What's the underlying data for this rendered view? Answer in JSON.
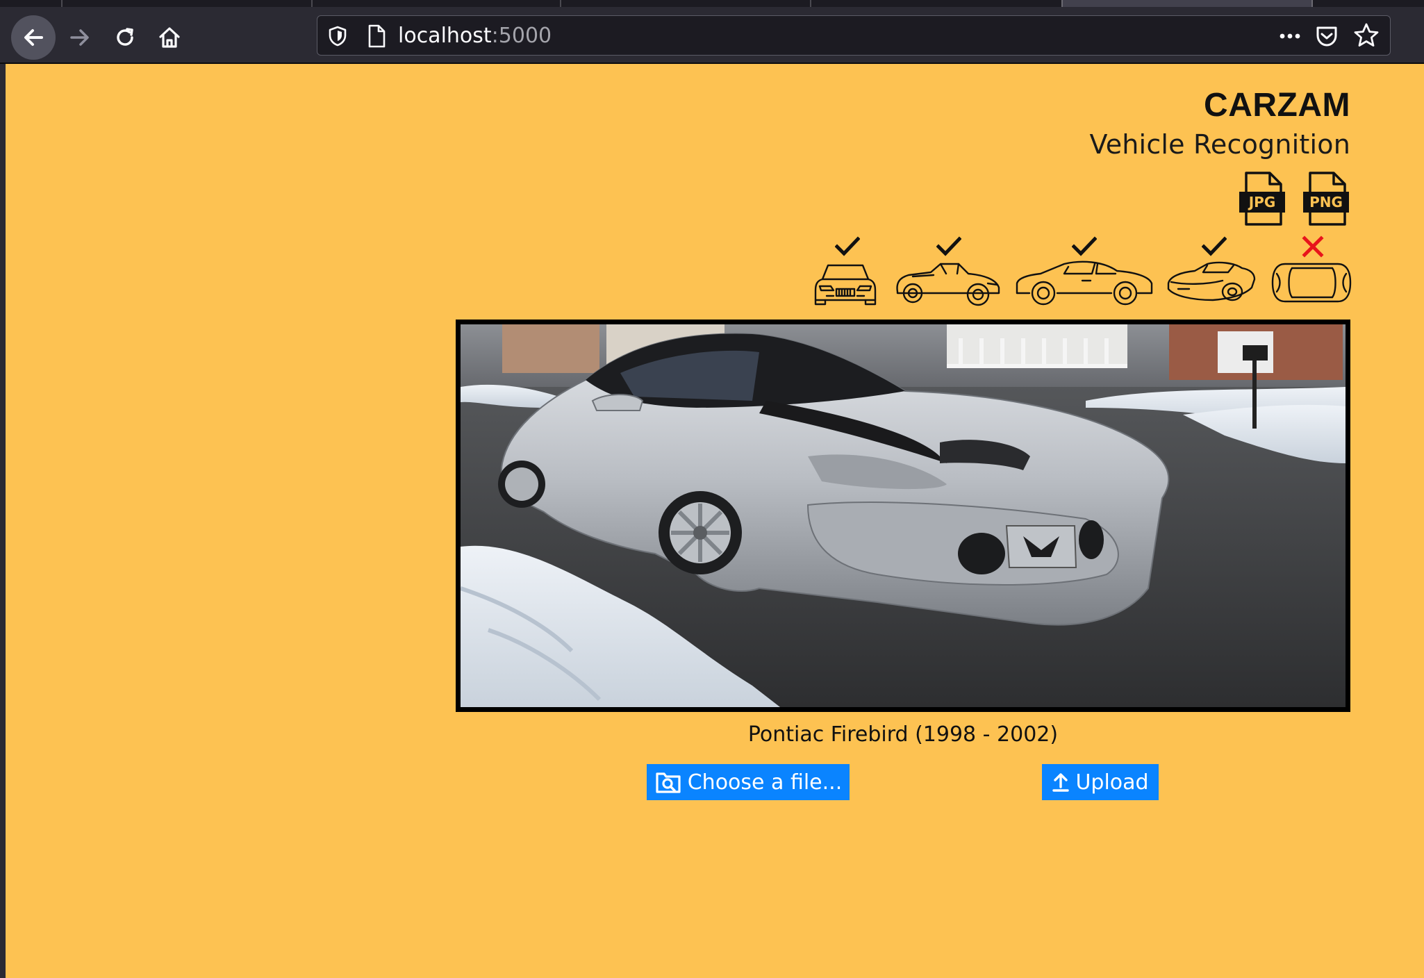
{
  "browser": {
    "url_host": "localhost",
    "url_port": ":5000",
    "icons": [
      "back-arrow-icon",
      "forward-arrow-icon",
      "reload-icon",
      "home-icon",
      "shield-icon",
      "page-icon",
      "more-icon",
      "pocket-icon",
      "star-icon"
    ]
  },
  "header": {
    "title": "CARZAM",
    "subtitle": "Vehicle Recognition"
  },
  "formats": [
    {
      "label": "JPG",
      "icon": "jpg-file-icon"
    },
    {
      "label": "PNG",
      "icon": "png-file-icon"
    }
  ],
  "orientations": [
    {
      "view": "front",
      "supported": true,
      "icon": "car-front-icon"
    },
    {
      "view": "front-three-quarter",
      "supported": true,
      "icon": "car-front-three-quarter-icon"
    },
    {
      "view": "side",
      "supported": true,
      "icon": "car-side-icon"
    },
    {
      "view": "rear-three-quarter",
      "supported": true,
      "icon": "car-three-quarter-icon"
    },
    {
      "view": "top",
      "supported": false,
      "icon": "car-top-icon"
    }
  ],
  "result": {
    "label": "Pontiac Firebird (1998 - 2002)"
  },
  "actions": {
    "choose_label": "Choose a file...",
    "upload_label": "Upload"
  },
  "colors": {
    "page_background": "#FDC252",
    "button": "#0A84FF",
    "check": "#111111",
    "cross": "#E8141B"
  }
}
